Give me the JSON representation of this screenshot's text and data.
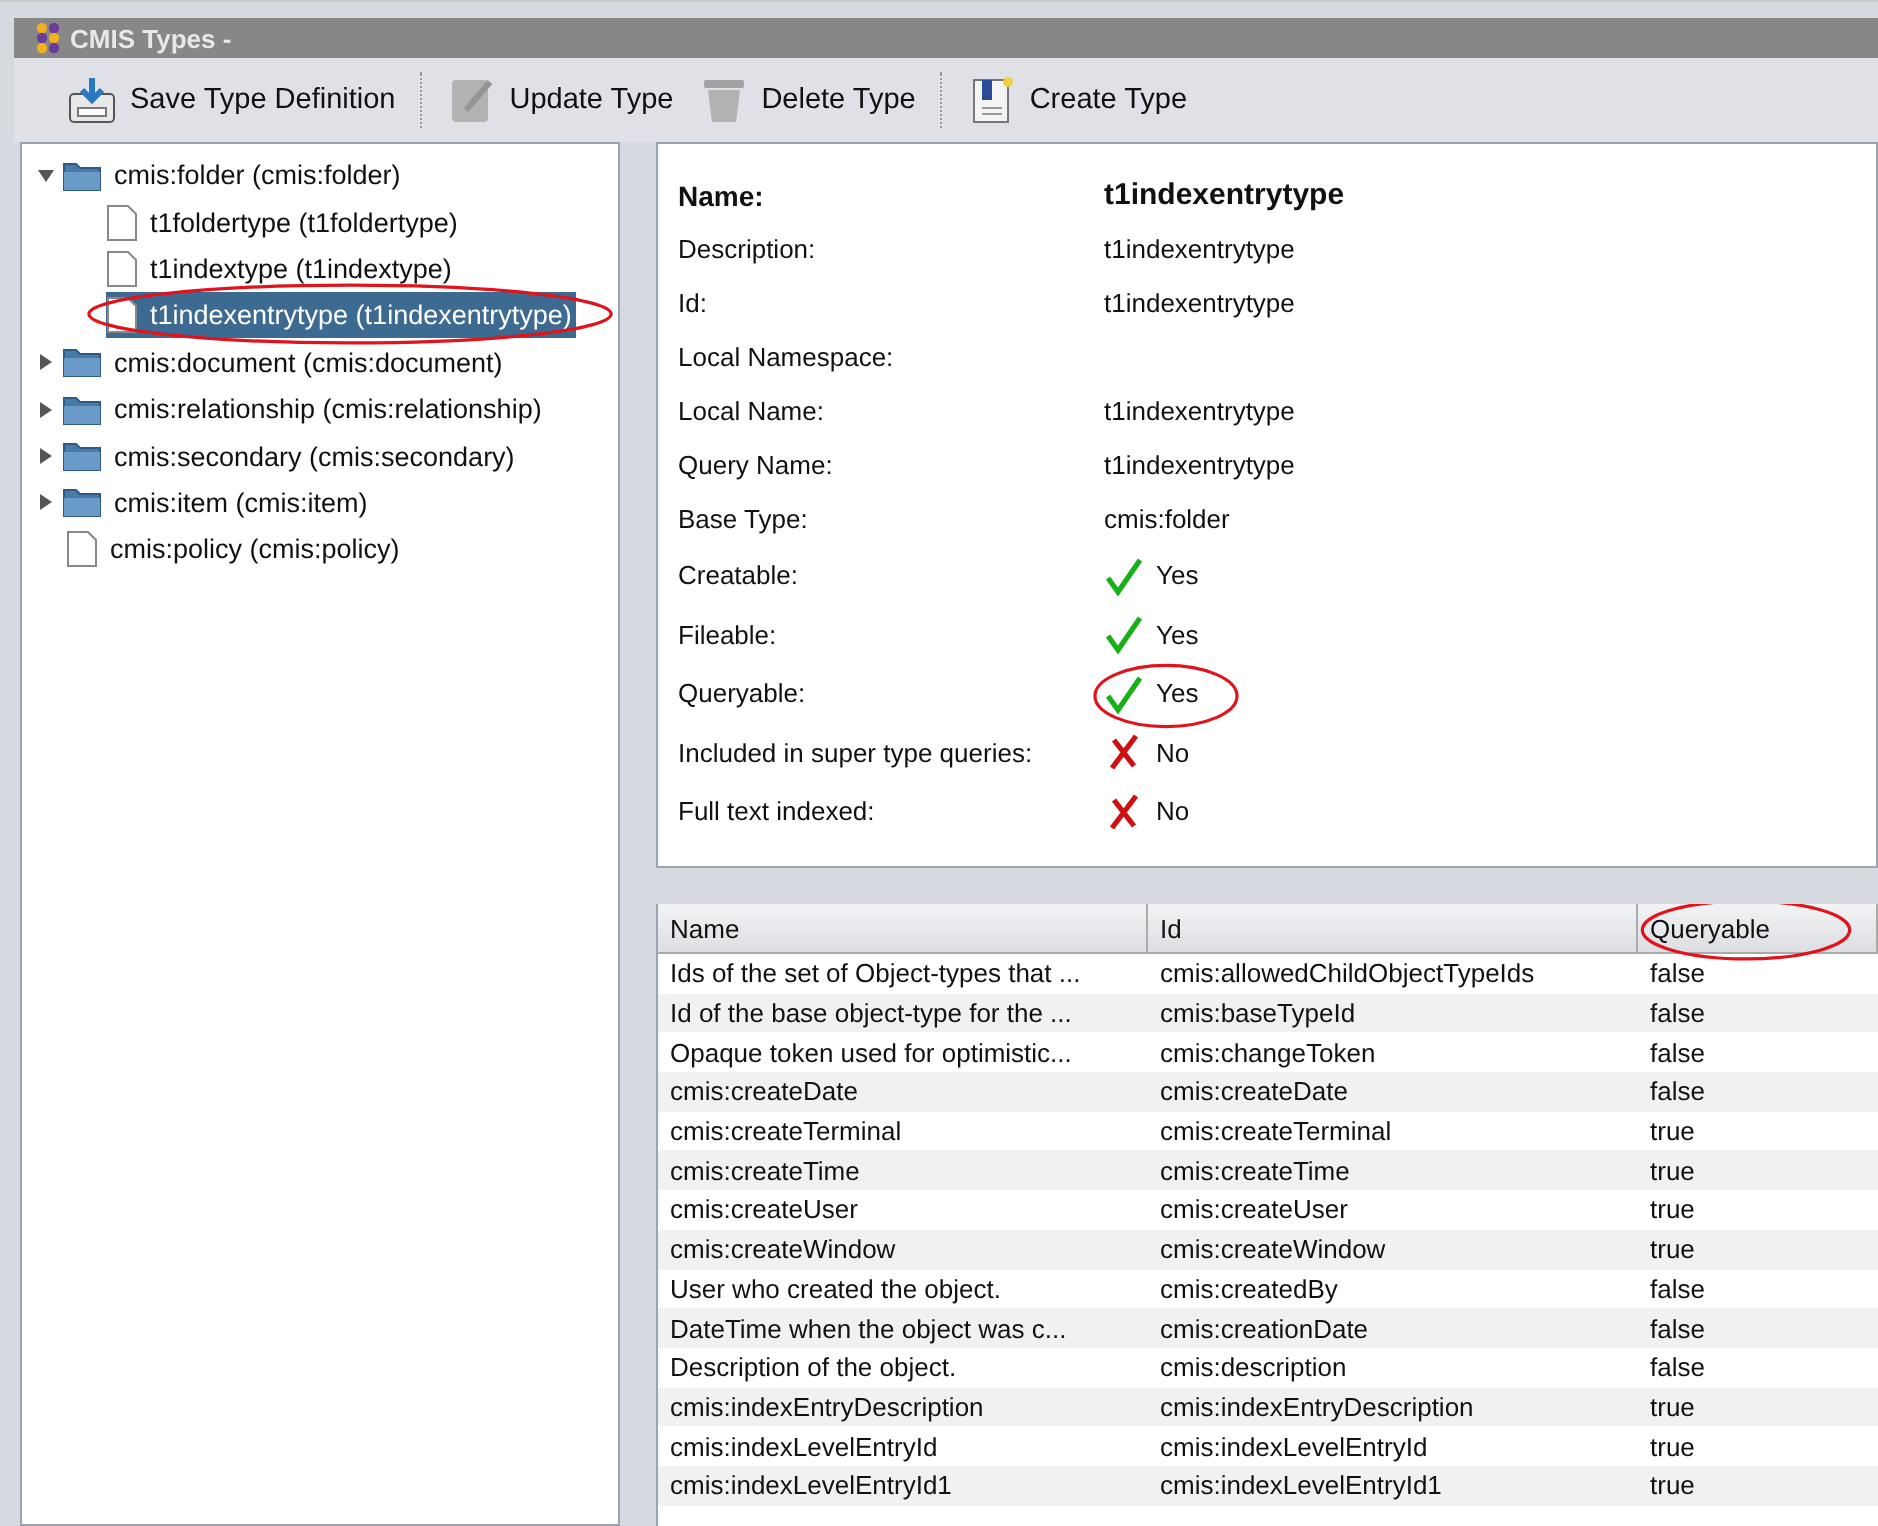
{
  "window": {
    "title": "CMIS Types -"
  },
  "toolbar": [
    {
      "label": "Save Type Definition",
      "kind": "save",
      "disabled": false
    },
    {
      "label": "Update Type",
      "kind": "update",
      "disabled": true
    },
    {
      "label": "Delete Type",
      "kind": "delete",
      "disabled": true
    },
    {
      "label": "Create Type",
      "kind": "create",
      "disabled": false
    }
  ],
  "tree": [
    {
      "label": "cmis:folder (cmis:folder)",
      "kind": "folder",
      "expanded": true,
      "selected": false,
      "children": [
        {
          "label": "t1foldertype (t1foldertype)",
          "kind": "file",
          "selected": false
        },
        {
          "label": "t1indextype (t1indextype)",
          "kind": "file",
          "selected": false
        },
        {
          "label": "t1indexentrytype (t1indexentrytype)",
          "kind": "file",
          "selected": true,
          "circled": true
        }
      ]
    },
    {
      "label": "cmis:document (cmis:document)",
      "kind": "folder",
      "expanded": false,
      "selected": false
    },
    {
      "label": "cmis:relationship (cmis:relationship)",
      "kind": "folder",
      "expanded": false,
      "selected": false
    },
    {
      "label": "cmis:secondary (cmis:secondary)",
      "kind": "folder",
      "expanded": false,
      "selected": false
    },
    {
      "label": "cmis:item (cmis:item)",
      "kind": "folder",
      "expanded": false,
      "selected": false
    },
    {
      "label": "cmis:policy (cmis:policy)",
      "kind": "file",
      "selected": false
    }
  ],
  "details": {
    "name_label": "Name:",
    "name_value": "t1indexentrytype",
    "fields": [
      {
        "label": "Description:",
        "value": "t1indexentrytype",
        "kind": "text"
      },
      {
        "label": "Id:",
        "value": "t1indexentrytype",
        "kind": "text"
      },
      {
        "label": "Local Namespace:",
        "kind": "text"
      },
      {
        "label": "Local Name:",
        "value": "t1indexentrytype",
        "kind": "text"
      },
      {
        "label": "Query Name:",
        "value": "t1indexentrytype",
        "kind": "text"
      },
      {
        "label": "Base Type:",
        "value": "cmis:folder",
        "kind": "text"
      },
      {
        "label": "Creatable:",
        "value": "Yes",
        "kind": "bool",
        "checked": true
      },
      {
        "label": "Fileable:",
        "value": "Yes",
        "kind": "bool",
        "checked": true
      },
      {
        "label": "Queryable:",
        "value": "Yes",
        "kind": "bool",
        "checked": true,
        "circled": true
      },
      {
        "label": "Included in super type queries:",
        "value": "No",
        "kind": "bool",
        "checked": false
      },
      {
        "label": "Full text indexed:",
        "value": "No",
        "kind": "bool",
        "checked": false
      }
    ]
  },
  "table": {
    "columns": [
      {
        "label": "Name"
      },
      {
        "label": "Id"
      },
      {
        "label": "Queryable",
        "circled": true
      }
    ],
    "rows": [
      [
        "Ids of the set of Object-types that ...",
        "cmis:allowedChildObjectTypeIds",
        "false"
      ],
      [
        "Id of the base object-type for the ...",
        "cmis:baseTypeId",
        "false"
      ],
      [
        "Opaque token used for optimistic...",
        "cmis:changeToken",
        "false"
      ],
      [
        "cmis:createDate",
        "cmis:createDate",
        "false"
      ],
      [
        "cmis:createTerminal",
        "cmis:createTerminal",
        "true"
      ],
      [
        "cmis:createTime",
        "cmis:createTime",
        "true"
      ],
      [
        "cmis:createUser",
        "cmis:createUser",
        "true"
      ],
      [
        "cmis:createWindow",
        "cmis:createWindow",
        "true"
      ],
      [
        "User who created the object.",
        "cmis:createdBy",
        "false"
      ],
      [
        "DateTime when the object was c...",
        "cmis:creationDate",
        "false"
      ],
      [
        "Description of the object.",
        "cmis:description",
        "false"
      ],
      [
        "cmis:indexEntryDescription",
        "cmis:indexEntryDescription",
        "true"
      ],
      [
        "cmis:indexLevelEntryId",
        "cmis:indexLevelEntryId",
        "true"
      ],
      [
        "cmis:indexLevelEntryId1",
        "cmis:indexLevelEntryId1",
        "true"
      ]
    ]
  }
}
